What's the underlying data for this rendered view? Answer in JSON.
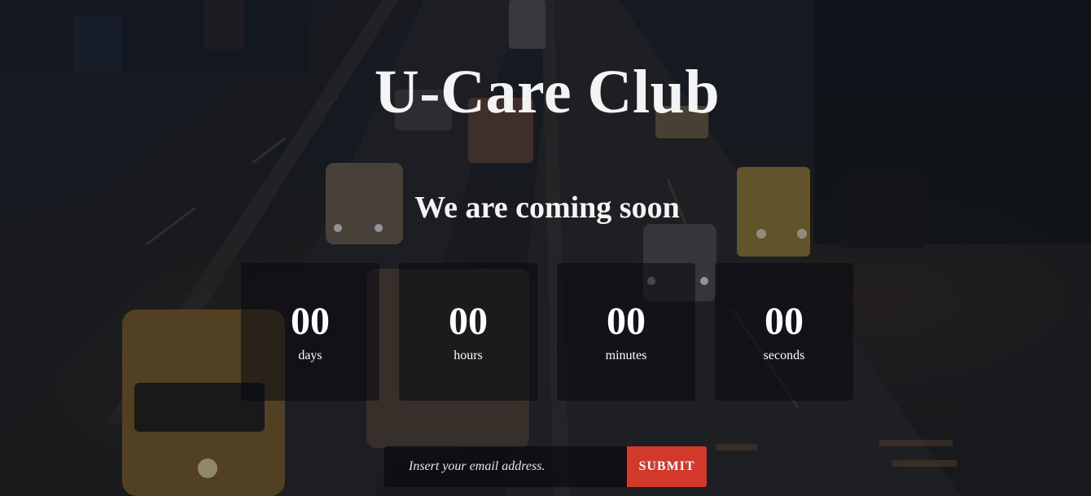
{
  "page": {
    "title": "U-Care Club",
    "subtitle": "We are coming soon"
  },
  "countdown": [
    {
      "value": "00",
      "label": "days"
    },
    {
      "value": "00",
      "label": "hours"
    },
    {
      "value": "00",
      "label": "minutes"
    },
    {
      "value": "00",
      "label": "seconds"
    }
  ],
  "subscribe": {
    "placeholder": "Insert your email address.",
    "submit_label": "SUBMIT"
  },
  "colors": {
    "accent": "#d2392b",
    "text": "#ffffff",
    "box": "rgba(8,10,16,0.55)"
  },
  "background": {
    "description_icon": "night-highway-photo"
  }
}
